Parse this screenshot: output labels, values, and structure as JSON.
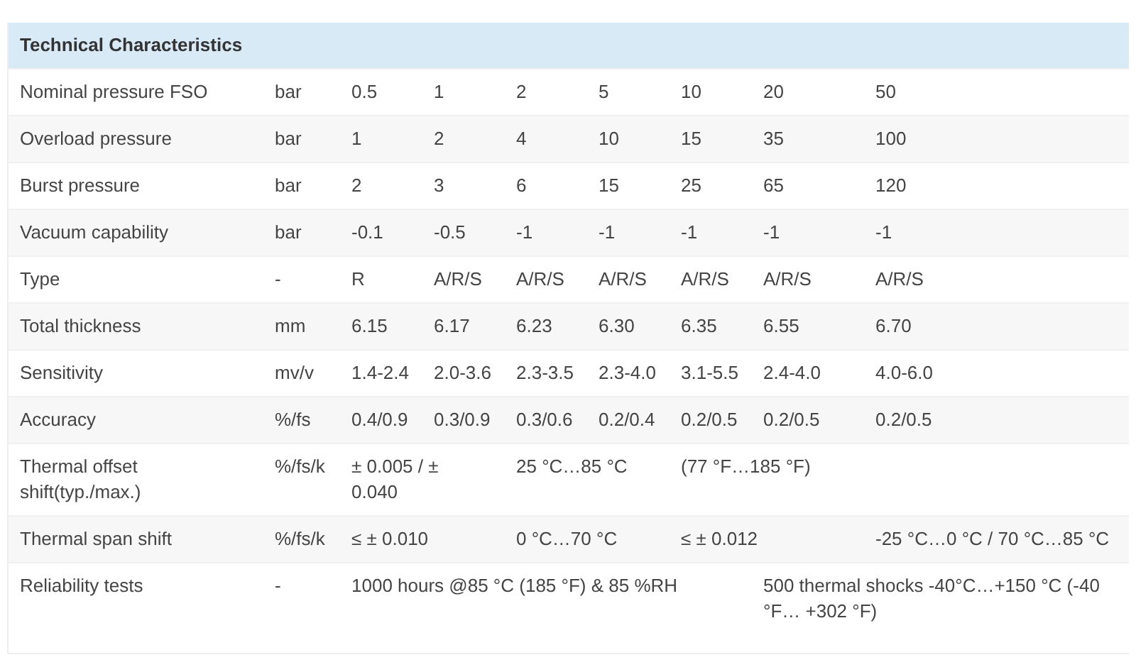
{
  "table": {
    "title": "Technical Characteristics",
    "rows": [
      {
        "cells": [
          {
            "text": "Nominal pressure FSO"
          },
          {
            "text": "bar"
          },
          {
            "text": "0.5"
          },
          {
            "text": "1"
          },
          {
            "text": "2"
          },
          {
            "text": "5"
          },
          {
            "text": "10"
          },
          {
            "text": "20"
          },
          {
            "text": "50"
          }
        ]
      },
      {
        "cells": [
          {
            "text": "Overload pressure"
          },
          {
            "text": "bar"
          },
          {
            "text": "1"
          },
          {
            "text": "2"
          },
          {
            "text": "4"
          },
          {
            "text": "10"
          },
          {
            "text": "15"
          },
          {
            "text": "35"
          },
          {
            "text": "100"
          }
        ]
      },
      {
        "cells": [
          {
            "text": "Burst pressure"
          },
          {
            "text": "bar"
          },
          {
            "text": "2"
          },
          {
            "text": "3"
          },
          {
            "text": "6"
          },
          {
            "text": "15"
          },
          {
            "text": "25"
          },
          {
            "text": "65"
          },
          {
            "text": "120"
          }
        ]
      },
      {
        "cells": [
          {
            "text": "Vacuum capability"
          },
          {
            "text": "bar"
          },
          {
            "text": "-0.1"
          },
          {
            "text": "-0.5"
          },
          {
            "text": "-1"
          },
          {
            "text": "-1"
          },
          {
            "text": "-1"
          },
          {
            "text": "-1"
          },
          {
            "text": "-1"
          }
        ]
      },
      {
        "cells": [
          {
            "text": "Type"
          },
          {
            "text": "-"
          },
          {
            "text": "R"
          },
          {
            "text": "A/R/S"
          },
          {
            "text": "A/R/S"
          },
          {
            "text": "A/R/S"
          },
          {
            "text": "A/R/S"
          },
          {
            "text": "A/R/S"
          },
          {
            "text": "A/R/S"
          }
        ]
      },
      {
        "cells": [
          {
            "text": "Total thickness"
          },
          {
            "text": "mm"
          },
          {
            "text": "6.15"
          },
          {
            "text": "6.17"
          },
          {
            "text": "6.23"
          },
          {
            "text": "6.30"
          },
          {
            "text": "6.35"
          },
          {
            "text": "6.55"
          },
          {
            "text": "6.70"
          }
        ]
      },
      {
        "cells": [
          {
            "text": "Sensitivity"
          },
          {
            "text": "mv/v"
          },
          {
            "text": "1.4-2.4"
          },
          {
            "text": "2.0-3.6"
          },
          {
            "text": "2.3-3.5"
          },
          {
            "text": "2.3-4.0"
          },
          {
            "text": "3.1-5.5"
          },
          {
            "text": "2.4-4.0"
          },
          {
            "text": "4.0-6.0"
          }
        ]
      },
      {
        "cells": [
          {
            "text": "Accuracy"
          },
          {
            "text": "%/fs"
          },
          {
            "text": "0.4/0.9"
          },
          {
            "text": "0.3/0.9"
          },
          {
            "text": "0.3/0.6"
          },
          {
            "text": "0.2/0.4"
          },
          {
            "text": "0.2/0.5"
          },
          {
            "text": "0.2/0.5"
          },
          {
            "text": "0.2/0.5"
          }
        ]
      },
      {
        "cells": [
          {
            "text": "Thermal offset shift(typ./max.)"
          },
          {
            "text": "%/fs/k"
          },
          {
            "text": "± 0.005 / ± 0.040",
            "colspan": 2
          },
          {
            "text": "25 °C…85 °C",
            "colspan": 2
          },
          {
            "text": "(77 °F…185 °F)",
            "colspan": 3
          }
        ]
      },
      {
        "cells": [
          {
            "text": "Thermal span shift"
          },
          {
            "text": "%/fs/k"
          },
          {
            "text": "≤ ± 0.010",
            "colspan": 2
          },
          {
            "text": "0 °C…70 °C",
            "colspan": 2
          },
          {
            "text": "≤ ± 0.012",
            "colspan": 2
          },
          {
            "text": "-25 °C…0 °C / 70 °C…85 °C"
          }
        ]
      },
      {
        "cells": [
          {
            "text": "Reliability tests"
          },
          {
            "text": "-"
          },
          {
            "text": "1000 hours @85 °C (185 °F) & 85 %RH",
            "colspan": 5
          },
          {
            "text": "500 thermal shocks -40°C…+150 °C (-40 °F… +302 °F)",
            "colspan": 2
          }
        ]
      }
    ]
  }
}
